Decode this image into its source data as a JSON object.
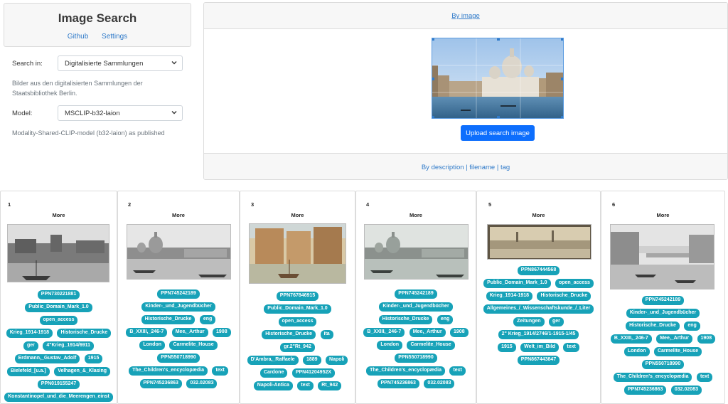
{
  "app": {
    "title": "Image Search",
    "nav": [
      "Github",
      "Settings"
    ]
  },
  "search_in": {
    "label": "Search in:",
    "value": "Digitalisierte Sammlungen",
    "help": "Bilder aus den digitalisierten Sammlungen der Staatsbibliothek Berlin."
  },
  "model": {
    "label": "Model:",
    "value": "MSCLIP-b32-laion",
    "help": "Modality-Shared-CLIP-model (b32-laion) as published"
  },
  "image_tab": {
    "link": "By image",
    "upload_label": "Upload search image"
  },
  "text_tab": {
    "description": "By description",
    "sep1": " | ",
    "filename": "filename",
    "sep2": " | ",
    "tag": "tag"
  },
  "more_label": "More",
  "results": [
    {
      "number": "1",
      "tags": [
        "PPN730221881",
        "Public_Domain_Mark_1.0",
        "open_access",
        "Krieg_1914-1918",
        "Historische_Drucke",
        "ger",
        "4\"Krieg_1914/6911",
        "Erdmann,_Gustav_Adolf",
        "1915",
        "Bielefeld_[u.a.]",
        "Velhagen_&_Klasing",
        "PPN019155247",
        "Konstantinopel_und_die_Meerengen_einst"
      ]
    },
    {
      "number": "2",
      "tags": [
        "PPN745242189",
        "Kinder-_und_Jugendbücher",
        "Historische_Drucke",
        "eng",
        "B_XXIII,_246-7",
        "Mee,_Arthur",
        "1908",
        "London",
        "Carmelite_House",
        "PPN550718990",
        "The_Children's_encyclopædia",
        "text",
        "PPN745236863",
        "032.02083"
      ]
    },
    {
      "number": "3",
      "tags": [
        "PPN767846915",
        "Public_Domain_Mark_1.0",
        "open_access",
        "Historische_Drucke",
        "ita",
        "gr.2\"Rt_942",
        "D'Ambra,_Raffaele",
        "1889",
        "Napoli",
        "Cardone",
        "PPN41204952X",
        "Napoli-Antica",
        "text",
        "Rt_942"
      ]
    },
    {
      "number": "4",
      "tags": [
        "PPN745242189",
        "Kinder-_und_Jugendbücher",
        "Historische_Drucke",
        "eng",
        "B_XXIII,_246-7",
        "Mee,_Arthur",
        "1908",
        "London",
        "Carmelite_House",
        "PPN550718990",
        "The_Children's_encyclopædia",
        "text",
        "PPN745236863",
        "032.02083"
      ]
    },
    {
      "number": "5",
      "tags": [
        "PPN867444568",
        "Public_Domain_Mark_1.0",
        "open_access",
        "Krieg_1914-1918",
        "Historische_Drucke",
        "Allgemeines_/_Wissenschaftskunde_/_Liter",
        "Zeitungen",
        "ger",
        "2\" Krieg_1914/2746/1-1915-1/45",
        "1915",
        "Welt_im_Bild",
        "text",
        "PPN867443847"
      ]
    },
    {
      "number": "6",
      "tags": [
        "PPN745242189",
        "Kinder-_und_Jugendbücher",
        "Historische_Drucke",
        "eng",
        "B_XXIII,_246-7",
        "Mee,_Arthur",
        "1908",
        "London",
        "Carmelite_House",
        "PPN550718990",
        "The_Children's_encyclopædia",
        "text",
        "PPN745236863",
        "032.02083"
      ]
    }
  ]
}
